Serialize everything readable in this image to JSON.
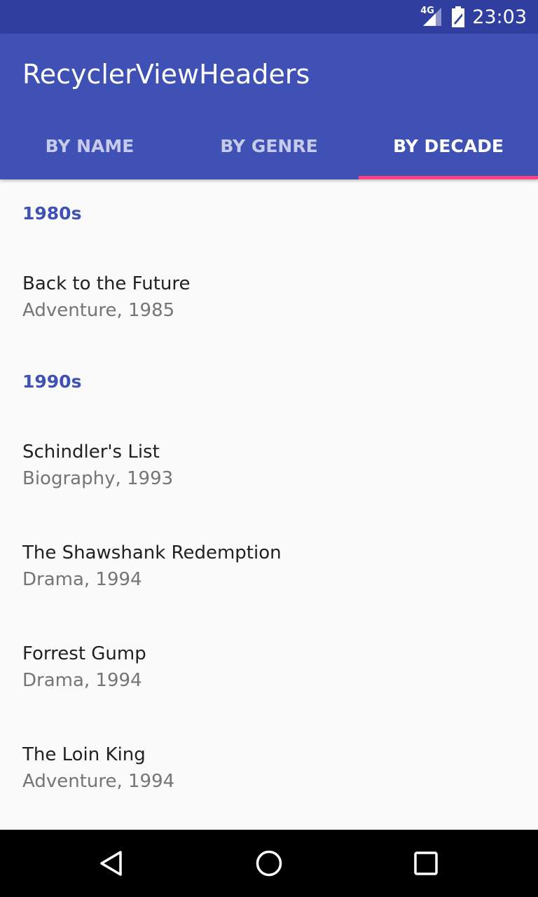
{
  "status_bar": {
    "network_label": "4G",
    "time": "23:03",
    "icons": [
      "signal-icon",
      "battery-icon"
    ]
  },
  "app_bar": {
    "title": "RecyclerViewHeaders",
    "color": "#3f51b5",
    "status_color": "#303f9f",
    "accent": "#ff4081"
  },
  "tabs": [
    {
      "label": "BY NAME",
      "active": false
    },
    {
      "label": "BY GENRE",
      "active": false
    },
    {
      "label": "BY DECADE",
      "active": true
    }
  ],
  "sections": [
    {
      "header": "1980s",
      "items": [
        {
          "title": "Back to the Future",
          "subtitle": "Adventure, 1985"
        }
      ]
    },
    {
      "header": "1990s",
      "items": [
        {
          "title": "Schindler's List",
          "subtitle": "Biography, 1993"
        },
        {
          "title": "The Shawshank Redemption",
          "subtitle": "Drama, 1994"
        },
        {
          "title": "Forrest Gump",
          "subtitle": "Drama, 1994"
        },
        {
          "title": "The Loin King",
          "subtitle": "Adventure, 1994"
        }
      ]
    }
  ],
  "nav_bar": {
    "icons": [
      "back-icon",
      "home-icon",
      "recents-icon"
    ]
  }
}
